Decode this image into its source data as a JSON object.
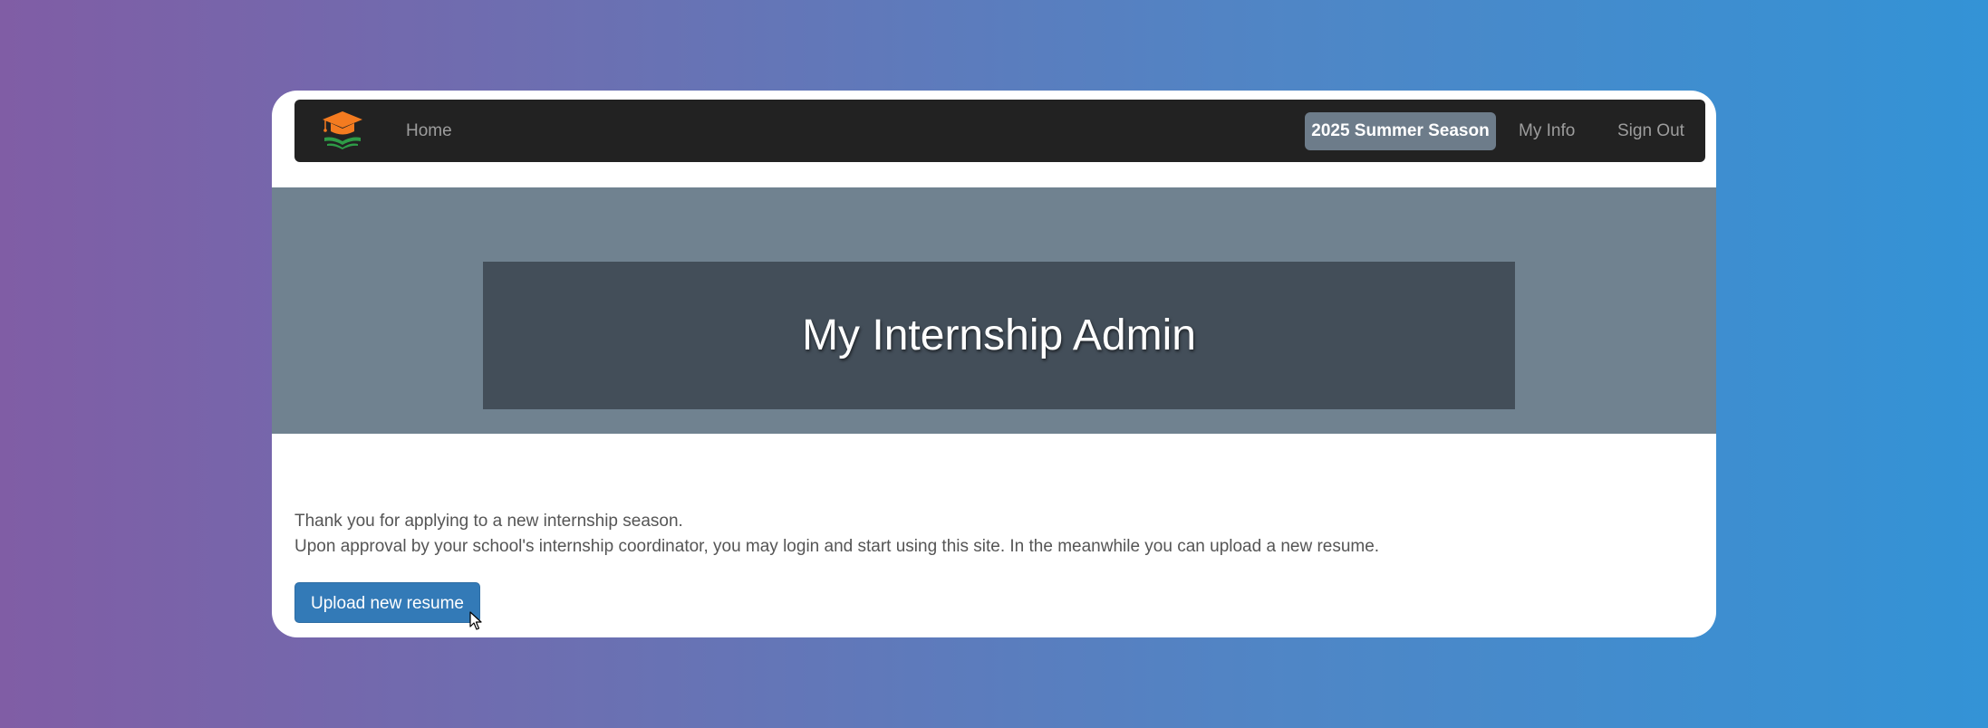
{
  "navbar": {
    "brand_icon": "graduation-cap-book-icon",
    "home_label": "Home",
    "season_label": "2025 Summer Season",
    "my_info_label": "My Info",
    "sign_out_label": "Sign Out"
  },
  "hero": {
    "title": "My Internship Admin"
  },
  "message": {
    "line1": "Thank you for applying to a new internship season.",
    "line2": "Upon approval by your school's internship coordinator, you may login and start using this site. In the meanwhile you can upload a new resume."
  },
  "actions": {
    "upload_label": "Upload new resume"
  },
  "colors": {
    "navbar_bg": "#222222",
    "season_badge_bg": "#6d7c8a",
    "hero_bg": "#708290",
    "hero_box_bg": "#434e59",
    "primary_button": "#337ab7",
    "brand_cap": "#f47b20",
    "brand_book": "#2e9b47"
  }
}
